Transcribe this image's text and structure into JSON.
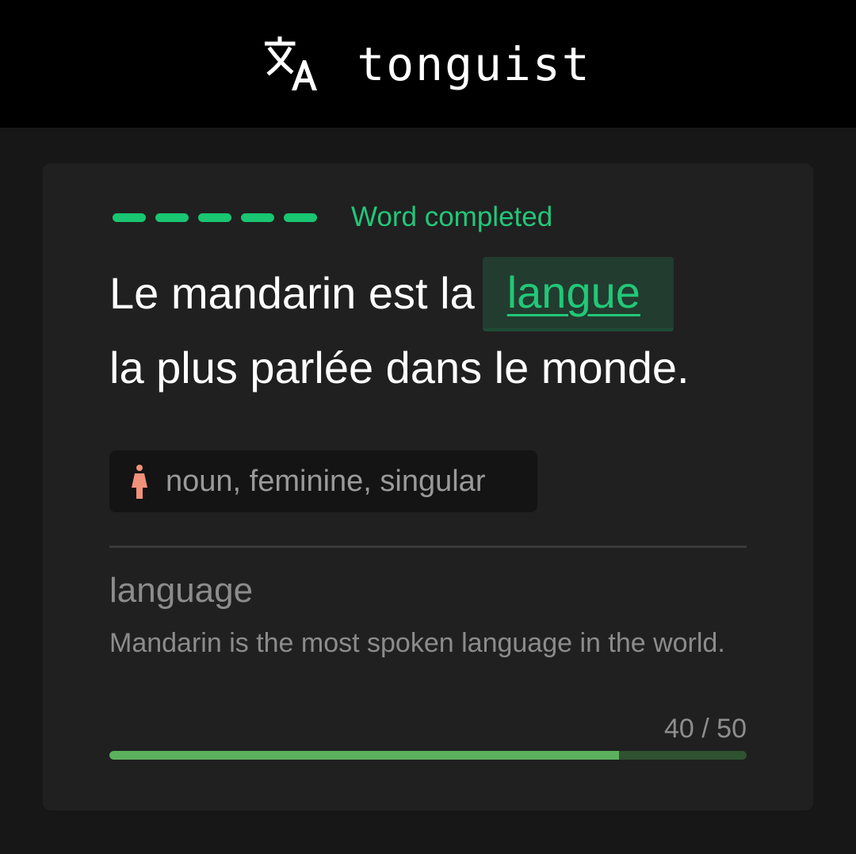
{
  "app": {
    "title": "tonguist",
    "logo_icon": "translate-icon"
  },
  "status": {
    "dash_count": 5,
    "text": "Word completed",
    "color": "#19c672"
  },
  "sentence": {
    "before": "Le mandarin est la",
    "word": "langue",
    "after": "la plus parlée dans le monde."
  },
  "grammar": {
    "icon": "female-person-icon",
    "text": "noun, feminine, singular",
    "icon_color": "#f0917a"
  },
  "translation": {
    "word": "language",
    "sentence": "Mandarin is the most spoken language in the world."
  },
  "progress": {
    "label": "40 / 50",
    "current": 40,
    "total": 50,
    "fill_color": "#5cb15e",
    "track_color": "#2f5230"
  }
}
